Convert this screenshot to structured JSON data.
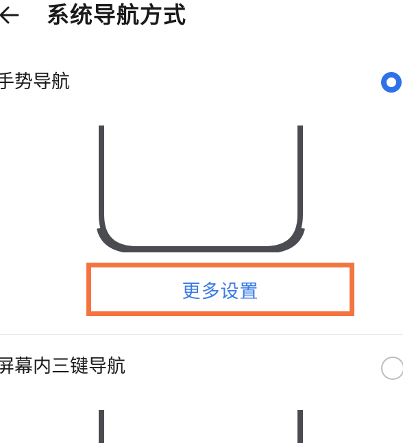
{
  "header": {
    "back_icon": "back-arrow-icon",
    "title": "系统导航方式"
  },
  "options": [
    {
      "label": "手势导航",
      "selected": true,
      "more_settings_label": "更多设置"
    },
    {
      "label": "屏幕内三键导航",
      "selected": false
    }
  ],
  "colors": {
    "accent": "#2e72ea",
    "link": "#3b7be4",
    "highlight_box": "#f47440",
    "phone_frame": "#4b4b52"
  }
}
